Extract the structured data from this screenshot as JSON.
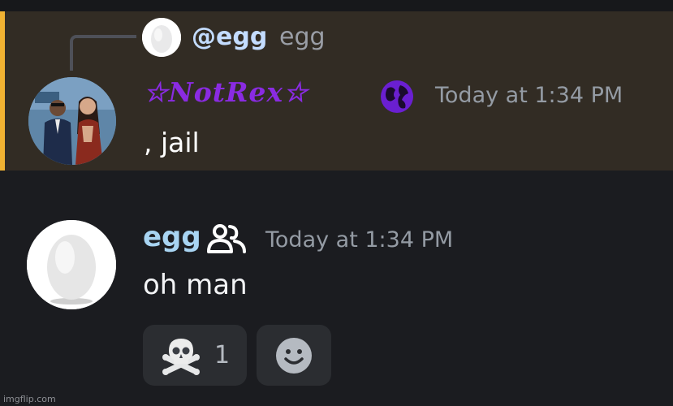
{
  "reply": {
    "name": "@egg",
    "text": "egg"
  },
  "message1": {
    "author": "☆𝑵𝒐𝒕𝑹𝒆𝒙☆",
    "badge_icon": "globe-icon",
    "timestamp": "Today at 1:34 PM",
    "body": ", jail"
  },
  "message2": {
    "author": "egg",
    "badge_icon": "people-icon",
    "timestamp": "Today at 1:34 PM",
    "body": "oh man"
  },
  "reactions": [
    {
      "emoji": "skull-and-crossbones-icon",
      "count": "1"
    }
  ],
  "add_reaction_icon": "smiley-icon",
  "watermark": "imgflip.com",
  "colors": {
    "background": "#1b1c20",
    "highlight": "#322c24",
    "highlight_bar": "#f0b232",
    "author1": "#8a2be2",
    "author2": "#a8d4f2",
    "reply_name": "#c3dcff"
  }
}
